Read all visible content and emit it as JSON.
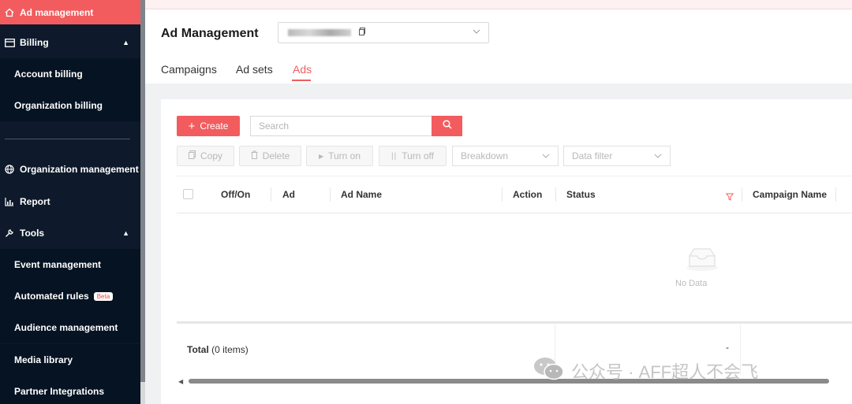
{
  "sidebar": {
    "items": [
      {
        "label": "Ad management",
        "icon": "home-icon"
      },
      {
        "label": "Billing",
        "icon": "billing-icon"
      },
      {
        "label": "Account billing"
      },
      {
        "label": "Organization billing"
      },
      {
        "label": "Organization management",
        "icon": "globe-icon"
      },
      {
        "label": "Report",
        "icon": "bar-chart-icon"
      },
      {
        "label": "Tools",
        "icon": "wrench-icon"
      },
      {
        "label": "Event management"
      },
      {
        "label": "Automated rules",
        "badge": "Beta"
      },
      {
        "label": "Audience management"
      },
      {
        "label": "Media library"
      },
      {
        "label": "Partner Integrations"
      }
    ]
  },
  "header": {
    "title": "Ad Management",
    "tabs": [
      {
        "label": "Campaigns"
      },
      {
        "label": "Ad sets"
      },
      {
        "label": "Ads",
        "active": true
      }
    ]
  },
  "toolbar": {
    "create_label": "Create",
    "search_placeholder": "Search",
    "copy_label": "Copy",
    "delete_label": "Delete",
    "turn_on_label": "Turn on",
    "turn_off_label": "Turn off",
    "breakdown_label": "Breakdown",
    "data_filter_label": "Data filter"
  },
  "table": {
    "columns": [
      "Off/On",
      "Ad",
      "Ad Name",
      "Action",
      "Status",
      "Campaign Name"
    ],
    "empty_text": "No Data",
    "total_label": "Total",
    "total_count": "(0 items)",
    "summary_value": "-"
  },
  "watermark": "公众号 · AFF超人不会飞",
  "colors": {
    "accent": "#f25c5e",
    "sidebar_bg": "#0e1a2b"
  }
}
